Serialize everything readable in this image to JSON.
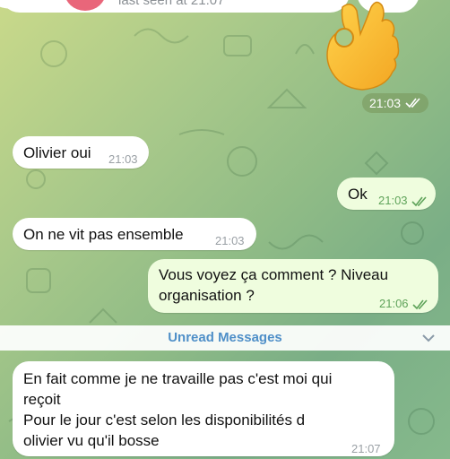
{
  "header": {
    "last_seen": "last seen at 21:07",
    "avatar_color": "#e9667a"
  },
  "messages": [
    {
      "id": "m0",
      "direction": "out",
      "type": "sticker",
      "emoji": "ok-hand",
      "time": "21:03",
      "read": true
    },
    {
      "id": "m1",
      "direction": "in",
      "text": "Olivier oui",
      "time": "21:03"
    },
    {
      "id": "m2",
      "direction": "out",
      "text": "Ok",
      "time": "21:03",
      "read": true
    },
    {
      "id": "m3",
      "direction": "in",
      "text": "On ne vit pas ensemble",
      "time": "21:03"
    },
    {
      "id": "m4",
      "direction": "out",
      "lines": [
        "Vous voyez ça comment ? Niveau",
        "organisation ?"
      ],
      "time": "21:06",
      "read": true
    },
    {
      "id": "m5",
      "direction": "in",
      "lines": [
        "En fait comme je ne travaille pas c'est moi qui",
        "reçoit",
        "Pour le jour c'est selon les disponibilités d",
        "olivier vu qu'il bosse"
      ],
      "time": "21:07"
    }
  ],
  "unread": {
    "label": "Unread Messages"
  },
  "colors": {
    "accent": "#4f8fc8",
    "out_bubble": "#effdde",
    "in_bubble": "#ffffff",
    "read_check": "#5fa35a"
  },
  "icons": [
    "ok-hand-emoji",
    "double-check-icon",
    "chevron-down-icon"
  ]
}
